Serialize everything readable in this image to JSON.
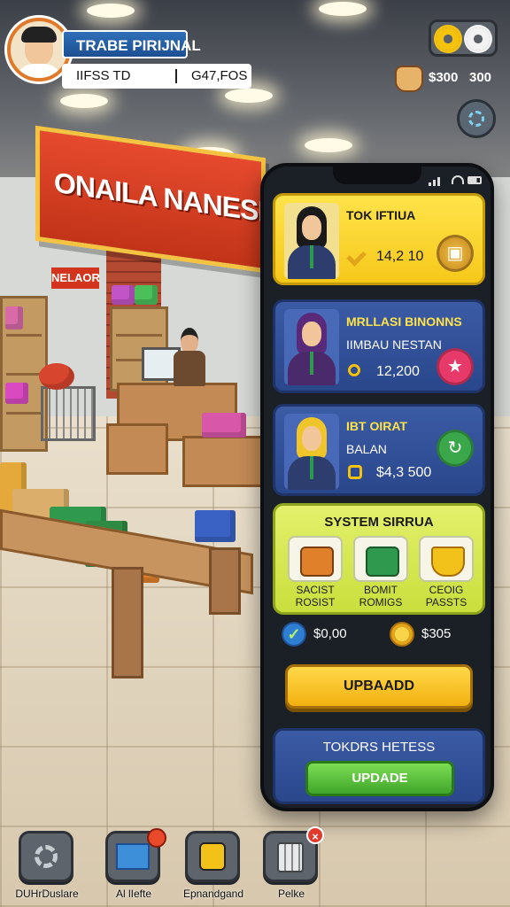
{
  "store": {
    "sign_text": "ONAILA NANESIA",
    "small_sign": "NELAOR"
  },
  "player": {
    "name": "TRABE PIRIJNAL",
    "stat_left": "IIFSS TD",
    "stat_right": "G47,FOS"
  },
  "currency": {
    "amount_1": "$300",
    "amount_2": "300"
  },
  "phone": {
    "cards": [
      {
        "title": "TOK IFTIUA",
        "value": "14,2 10",
        "color": "#f6c81a"
      },
      {
        "title": "MRLLASI BINONNS",
        "subtitle": "IIMBAU NESTAN",
        "value": "12,200",
        "color": "#2a478c"
      },
      {
        "title": "IBT OIRAT",
        "subtitle": "BALAN",
        "value": "$4,3 500",
        "color": "#2a478c"
      }
    ],
    "system": {
      "title": "SYSTEM SIRRUA",
      "items": [
        {
          "label_line1": "SACIST",
          "label_line2": "ROSIST",
          "icon": "crate-icon"
        },
        {
          "label_line1": "BOMIT",
          "label_line2": "ROMIGS",
          "icon": "phone-icon"
        },
        {
          "label_line1": "CEOIG",
          "label_line2": "PASSTS",
          "icon": "gold-basket-icon"
        }
      ]
    },
    "balances": {
      "left": "$0,00",
      "right": "$305"
    },
    "upgrade_button": "UPBAADD",
    "update_panel": {
      "title": "TOKDRS HETESS",
      "button": "UPDADE"
    }
  },
  "nav": [
    {
      "label": "DUHrDuslare",
      "icon": "settings-gear-icon"
    },
    {
      "label": "Al lIefte",
      "icon": "chart-brush-icon"
    },
    {
      "label": "Epnandgand",
      "icon": "shopping-bag-icon"
    },
    {
      "label": "Pelke",
      "icon": "calculator-icon"
    }
  ],
  "colors": {
    "accent_yellow": "#f6c81a",
    "panel_blue": "#2a478c",
    "system_green": "#c9df3c",
    "update_green": "#3fa52a",
    "action_pink": "#e83a6a",
    "action_green": "#3aa84a"
  }
}
